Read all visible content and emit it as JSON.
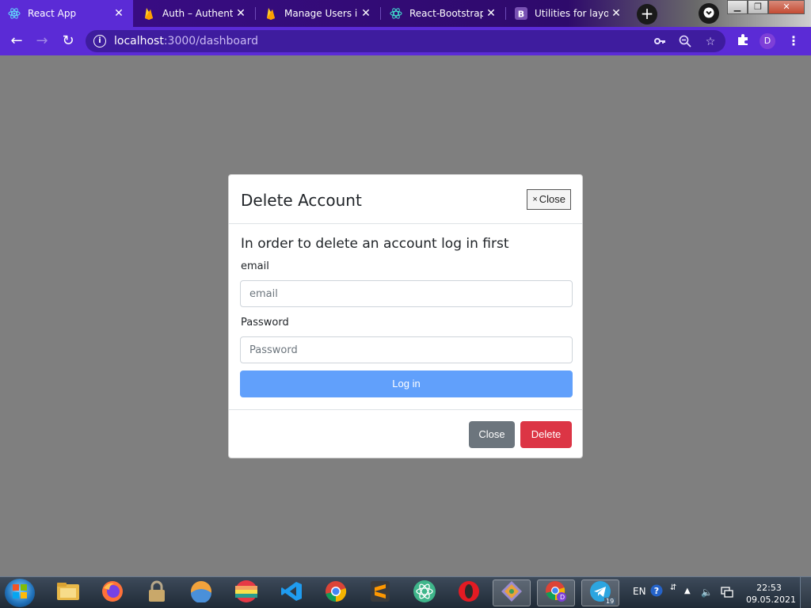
{
  "browser": {
    "tabs": [
      {
        "title": "React App",
        "icon": "react-icon",
        "active": true
      },
      {
        "title": "Auth – Authentica",
        "icon": "firebase-icon",
        "active": false
      },
      {
        "title": "Manage Users in",
        "icon": "firebase-icon",
        "active": false
      },
      {
        "title": "React-Bootstrap",
        "icon": "react-bootstrap-icon",
        "active": false
      },
      {
        "title": "Utilities for layout",
        "icon": "bootstrap-icon",
        "active": false
      }
    ],
    "new_tab": "+",
    "url_host": "localhost",
    "url_path": ":3000/dashboard",
    "profile_initial": "D",
    "accent": "#5b2bd6"
  },
  "modal": {
    "title": "Delete Account",
    "header_close_symbol": "×",
    "header_close_label": "Close",
    "heading": "In order to delete an account log in first",
    "email_label": "email",
    "email_placeholder": "email",
    "password_label": "Password",
    "password_placeholder": "Password",
    "login_label": "Log in",
    "close_label": "Close",
    "delete_label": "Delete",
    "colors": {
      "primary": "#61a0fb",
      "secondary": "#6c757d",
      "danger": "#dc3545"
    }
  },
  "taskbar": {
    "apps": [
      "file-explorer-icon",
      "firefox-icon",
      "lock-icon",
      "app-icon",
      "rainbow-app-icon",
      "vscode-icon",
      "chrome-icon",
      "sublime-text-icon",
      "atom-icon",
      "opera-icon",
      "git-app-icon",
      "chrome-profile-icon",
      "telegram-icon"
    ],
    "telegram_badge": "19",
    "chrome_profile_badge": "D",
    "language": "EN",
    "time": "22:53",
    "date": "09.05.2021"
  }
}
